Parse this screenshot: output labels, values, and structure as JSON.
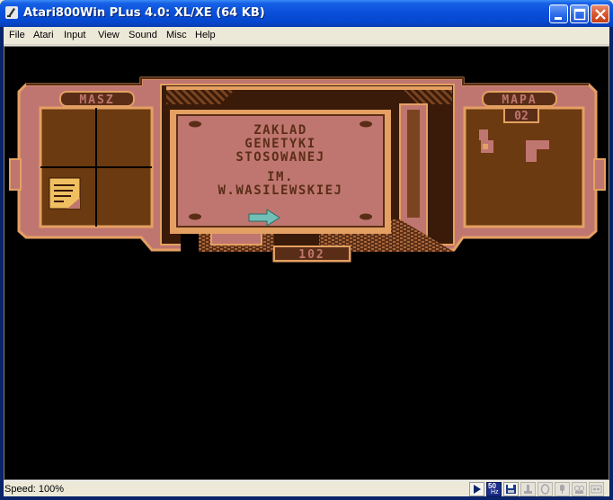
{
  "window": {
    "title": "Atari800Win PLus 4.0: XL/XE (64 KB)"
  },
  "menu": [
    "File",
    "Atari",
    "Input",
    "View",
    "Sound",
    "Misc",
    "Help"
  ],
  "game": {
    "left_label": "MASZ",
    "right_label": "MAPA",
    "map_number": "02",
    "room_number": "102",
    "sign_lines": [
      "ZAKLAD",
      "GENETYKI",
      "STOSOWANEJ",
      "IM.",
      "W.WASILEWSKIEJ"
    ]
  },
  "statusbar": {
    "speed": "Speed: 100%",
    "refresh_rate": "50",
    "refresh_unit": "Hz",
    "icons": [
      "run-icon",
      "refresh-rate-icon",
      "disk-icon",
      "joystick-icon",
      "mouse-icon",
      "microphone-icon",
      "sound-icon",
      "video-record-icon",
      "fullscreen-icon",
      "cassette-icon"
    ]
  },
  "colors": {
    "titlebar": "#0A50DA",
    "frame_pink": "#C07670",
    "frame_light": "#E4A062",
    "frame_dark": "#5A2E16",
    "panel_brown": "#6B3A10",
    "screen": "#000000"
  }
}
